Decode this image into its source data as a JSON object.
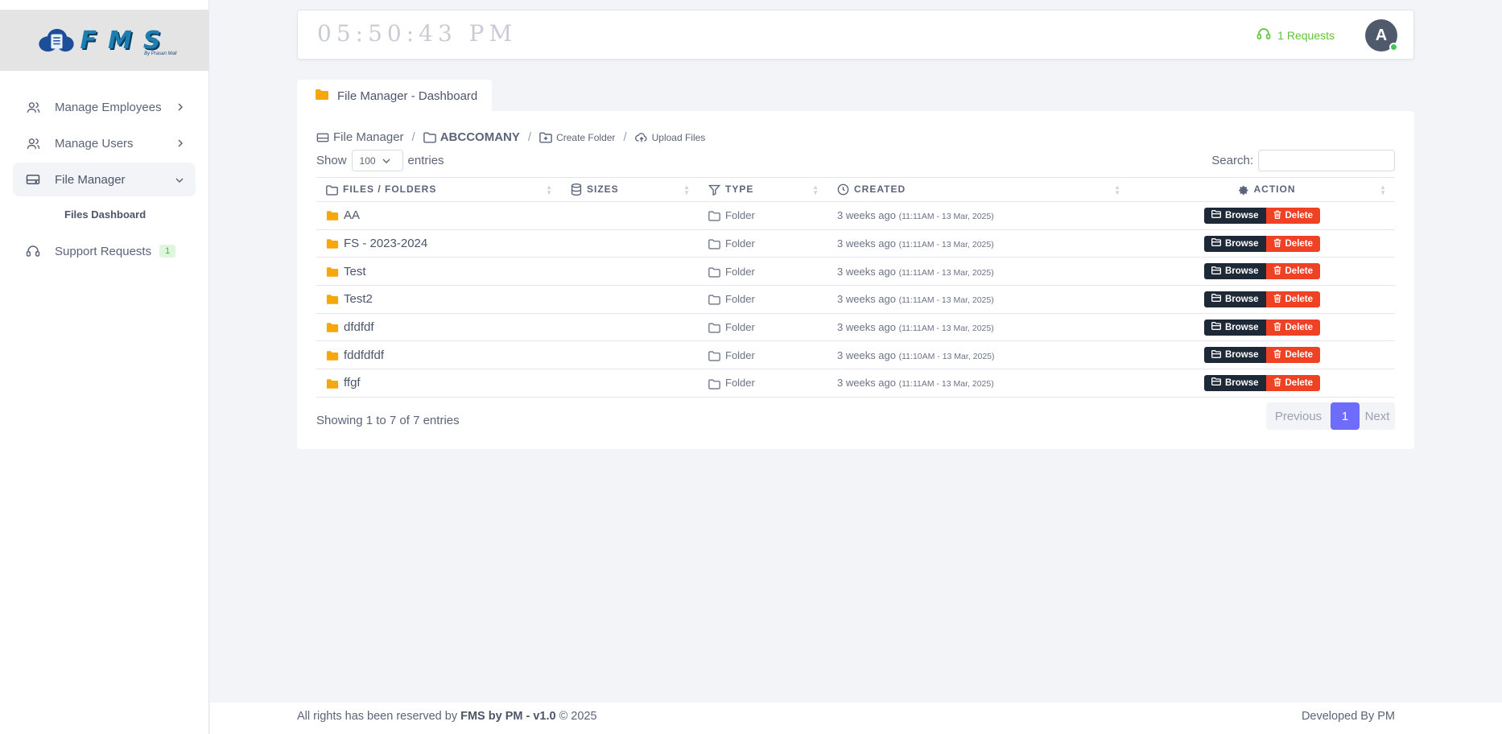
{
  "brand": {
    "logo_text": "FMS",
    "logo_sub": "By Prasan Mall"
  },
  "sidebar": {
    "items": [
      {
        "label": "Manage Employees"
      },
      {
        "label": "Manage Users"
      },
      {
        "label": "File Manager"
      },
      {
        "label": "Files Dashboard"
      },
      {
        "label": "Support Requests",
        "badge": "1"
      }
    ]
  },
  "topbar": {
    "clock": "05:50:43 PM",
    "requests": "1 Requests",
    "avatar_letter": "A"
  },
  "tab": {
    "label": "File Manager - Dashboard"
  },
  "breadcrumb": {
    "root": "File Manager",
    "folder": "ABCCOMANY",
    "create": "Create Folder",
    "upload": "Upload Files"
  },
  "controls": {
    "show_label": "Show",
    "page_size": "100",
    "entries_label": "entries",
    "search_label": "Search:"
  },
  "table": {
    "columns": [
      "Files / Folders",
      "Sizes",
      "Type",
      "Created",
      "Action"
    ],
    "rows": [
      {
        "name": "AA",
        "size": "",
        "type": "Folder",
        "created": "3 weeks ago",
        "created_detail": "(11:11AM - 13 Mar, 2025)"
      },
      {
        "name": "FS - 2023-2024",
        "size": "",
        "type": "Folder",
        "created": "3 weeks ago",
        "created_detail": "(11:11AM - 13 Mar, 2025)"
      },
      {
        "name": "Test",
        "size": "",
        "type": "Folder",
        "created": "3 weeks ago",
        "created_detail": "(11:11AM - 13 Mar, 2025)"
      },
      {
        "name": "Test2",
        "size": "",
        "type": "Folder",
        "created": "3 weeks ago",
        "created_detail": "(11:11AM - 13 Mar, 2025)"
      },
      {
        "name": "dfdfdf",
        "size": "",
        "type": "Folder",
        "created": "3 weeks ago",
        "created_detail": "(11:11AM - 13 Mar, 2025)"
      },
      {
        "name": "fddfdfdf",
        "size": "",
        "type": "Folder",
        "created": "3 weeks ago",
        "created_detail": "(11:10AM - 13 Mar, 2025)"
      },
      {
        "name": "ffgf",
        "size": "",
        "type": "Folder",
        "created": "3 weeks ago",
        "created_detail": "(11:11AM - 13 Mar, 2025)"
      }
    ],
    "browse_label": "Browse",
    "delete_label": "Delete"
  },
  "pagination": {
    "info": "Showing 1 to 7 of 7 entries",
    "prev": "Previous",
    "current": "1",
    "next": "Next"
  },
  "footer": {
    "left_prefix": "All rights has been reserved by",
    "left_brand": "FMS by PM - v1.0",
    "left_suffix": "© 2025",
    "right": "Developed By PM"
  },
  "colors": {
    "accent": "#6e6dfb",
    "folder": "#f5a70b",
    "browse": "#1e2938",
    "delete": "#ef4123",
    "online": "#44c65a",
    "requests": "#64c23c"
  }
}
